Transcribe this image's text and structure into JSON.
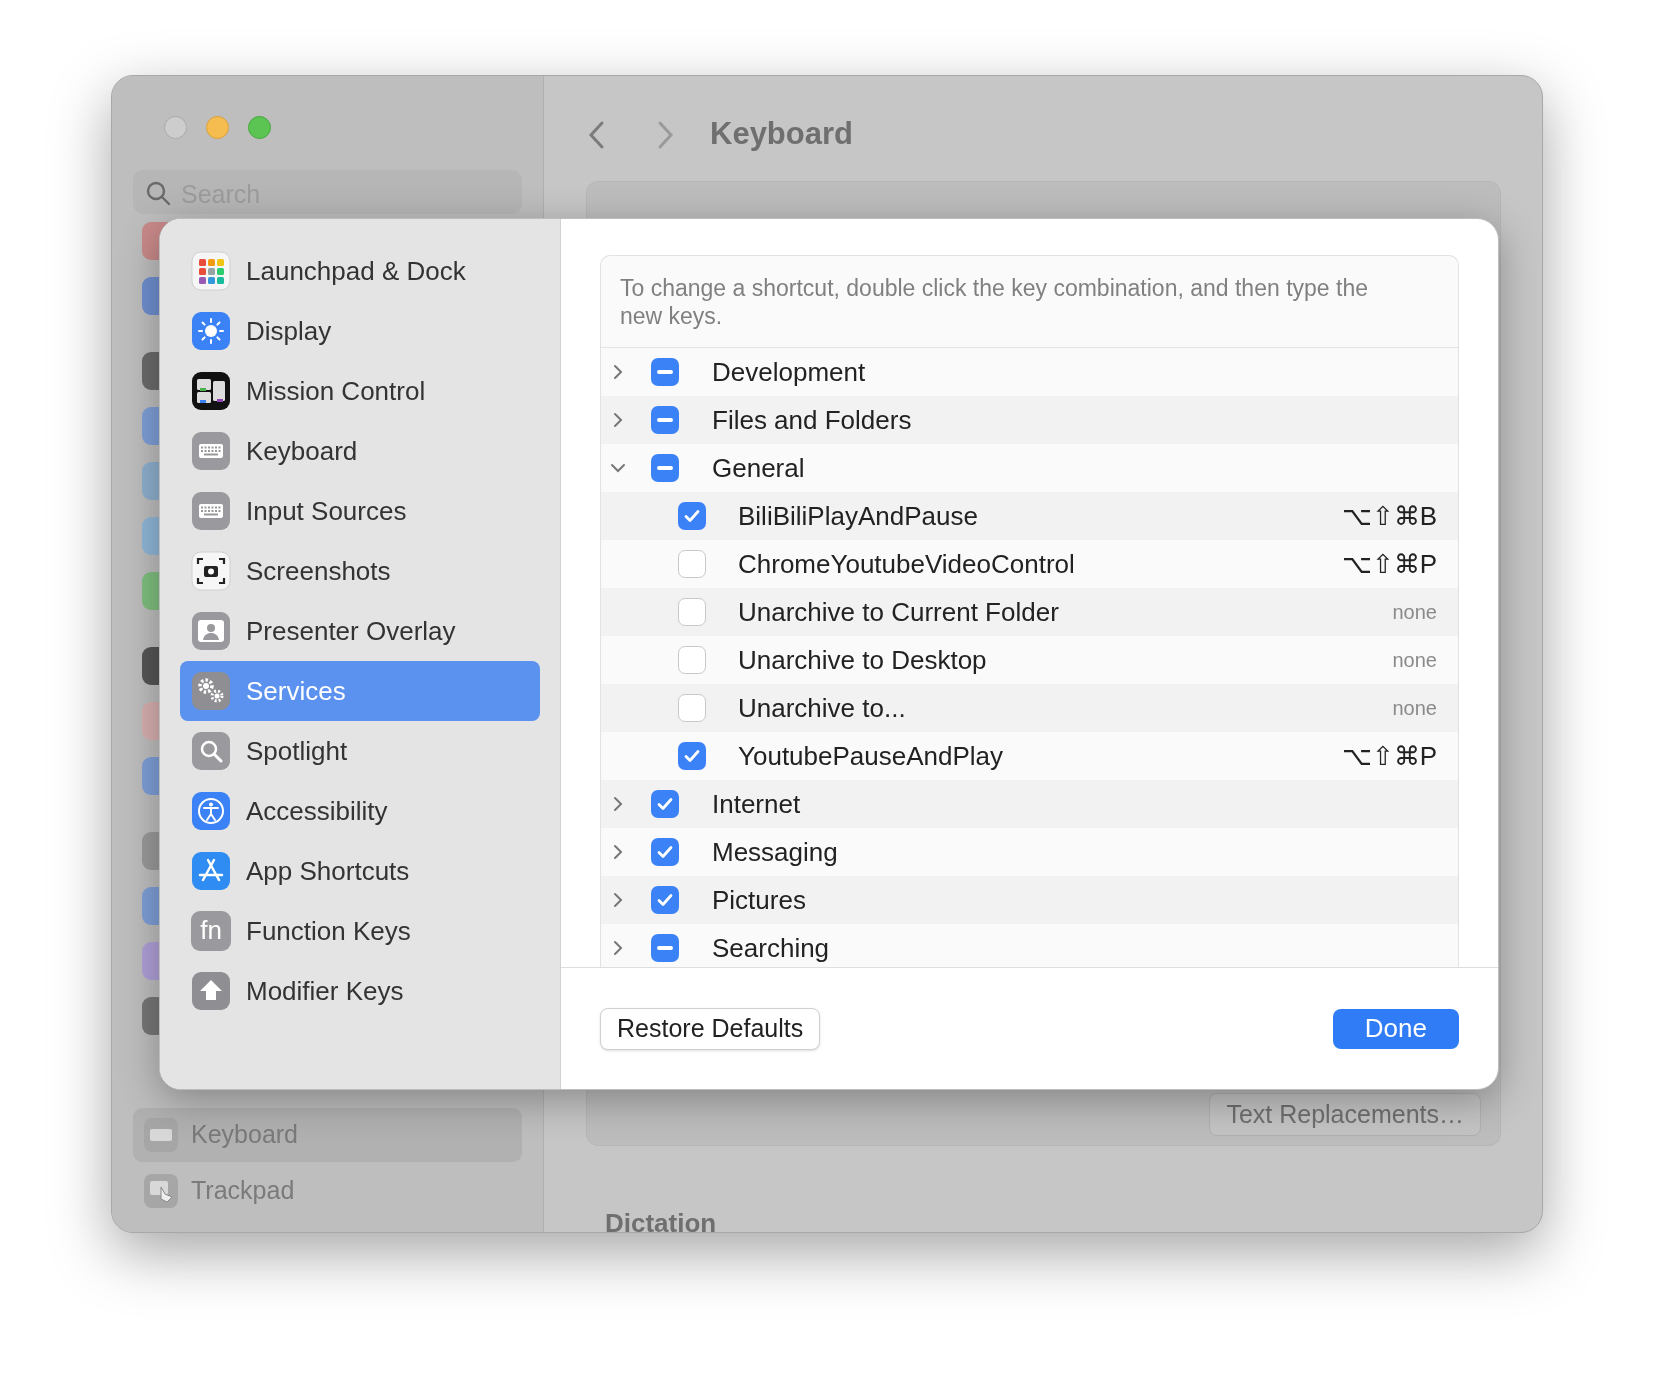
{
  "window": {
    "title": "Keyboard",
    "search": {
      "placeholder": "Search"
    },
    "text_replacements_button": "Text Replacements…",
    "section_heading": "Dictation",
    "sidebar_items": [
      {
        "label": "Keyboard",
        "kind": "keyboard",
        "selected": true
      },
      {
        "label": "Trackpad",
        "kind": "trackpad",
        "selected": false
      }
    ]
  },
  "sheet": {
    "sidebar": [
      {
        "label": "Launchpad & Dock",
        "kind": "launchpad",
        "selected": false
      },
      {
        "label": "Display",
        "kind": "display",
        "selected": false
      },
      {
        "label": "Mission Control",
        "kind": "mission",
        "selected": false
      },
      {
        "label": "Keyboard",
        "kind": "keyboard",
        "selected": false
      },
      {
        "label": "Input Sources",
        "kind": "keyboard",
        "selected": false
      },
      {
        "label": "Screenshots",
        "kind": "screenshot",
        "selected": false
      },
      {
        "label": "Presenter Overlay",
        "kind": "presenter",
        "selected": false
      },
      {
        "label": "Services",
        "kind": "gears",
        "selected": true
      },
      {
        "label": "Spotlight",
        "kind": "search",
        "selected": false
      },
      {
        "label": "Accessibility",
        "kind": "accessibility",
        "selected": false
      },
      {
        "label": "App Shortcuts",
        "kind": "appstore",
        "selected": false
      },
      {
        "label": "Function Keys",
        "kind": "fn",
        "icon_text": "fn",
        "selected": false
      },
      {
        "label": "Modifier Keys",
        "kind": "shift",
        "selected": false
      }
    ],
    "hint": "To change a shortcut, double click the key combination, and then type the new keys.",
    "groups": [
      {
        "label": "Development",
        "expanded": false,
        "mixed": true
      },
      {
        "label": "Files and Folders",
        "expanded": false,
        "mixed": true
      },
      {
        "label": "General",
        "expanded": true,
        "mixed": true,
        "children": [
          {
            "label": "BiliBiliPlayAndPause",
            "checked": true,
            "shortcut": "⌥⇧⌘B",
            "assigned": true
          },
          {
            "label": "ChromeYoutubeVideoControl",
            "checked": false,
            "shortcut": "⌥⇧⌘P",
            "assigned": true
          },
          {
            "label": "Unarchive to Current Folder",
            "checked": false,
            "shortcut": "none",
            "assigned": false
          },
          {
            "label": "Unarchive to Desktop",
            "checked": false,
            "shortcut": "none",
            "assigned": false
          },
          {
            "label": "Unarchive to...",
            "checked": false,
            "shortcut": "none",
            "assigned": false
          },
          {
            "label": "YoutubePauseAndPlay",
            "checked": true,
            "shortcut": "⌥⇧⌘P",
            "assigned": true
          }
        ]
      },
      {
        "label": "Internet",
        "expanded": false,
        "checked": true
      },
      {
        "label": "Messaging",
        "expanded": false,
        "checked": true
      },
      {
        "label": "Pictures",
        "expanded": false,
        "checked": true
      },
      {
        "label": "Searching",
        "expanded": false,
        "mixed": true
      }
    ],
    "buttons": [
      {
        "label": "Restore Defaults",
        "kind": "secondary"
      },
      {
        "label": "Done",
        "kind": "primary"
      }
    ]
  }
}
